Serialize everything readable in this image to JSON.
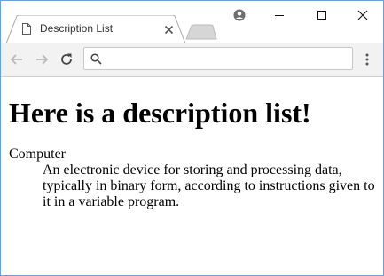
{
  "browser": {
    "tab": {
      "title": "Description List",
      "icon": "document-icon"
    },
    "controls": [
      "profile-icon",
      "minimize-icon",
      "maximize-icon",
      "close-icon"
    ],
    "address_bar": {
      "value": "",
      "placeholder": ""
    },
    "accent_border_color": "#6f9ed6"
  },
  "page": {
    "heading": "Here is a description list!",
    "description_list": [
      {
        "term": "Computer",
        "definition": "An electronic device for storing and processing data, typically in binary form, according to instructions given to it in a variable program."
      }
    ]
  }
}
